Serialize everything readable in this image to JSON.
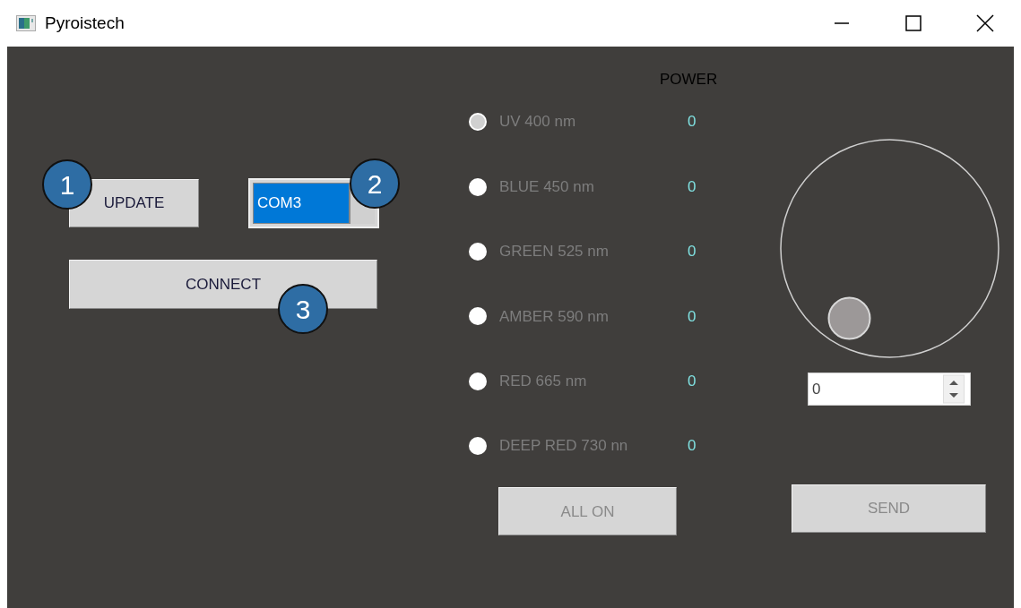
{
  "window": {
    "title": "Pyroistech"
  },
  "left": {
    "update_button": {
      "label": "UPDATE",
      "disabled": false
    },
    "port_combo": {
      "value": "COM3"
    },
    "connect_button": {
      "label": "CONNECT",
      "disabled": false
    }
  },
  "channels_header": "POWER",
  "channels": [
    {
      "label": "UV 400 nm",
      "value": "0",
      "selected": true,
      "disabled": true
    },
    {
      "label": "BLUE 450 nm",
      "value": "0",
      "selected": false,
      "disabled": true
    },
    {
      "label": "GREEN 525 nm",
      "value": "0",
      "selected": false,
      "disabled": true
    },
    {
      "label": "AMBER 590 nm",
      "value": "0",
      "selected": false,
      "disabled": true
    },
    {
      "label": "RED 665 nm",
      "value": "0",
      "selected": false,
      "disabled": true
    },
    {
      "label": "DEEP RED 730 nn",
      "value": "0",
      "selected": false,
      "disabled": true
    }
  ],
  "all_on_button": {
    "label": "ALL ON",
    "disabled": true
  },
  "spin_box": {
    "value": "0"
  },
  "send_button": {
    "label": "SEND",
    "disabled": true
  },
  "annotations": [
    {
      "label": "1"
    },
    {
      "label": "2"
    },
    {
      "label": "3"
    }
  ]
}
